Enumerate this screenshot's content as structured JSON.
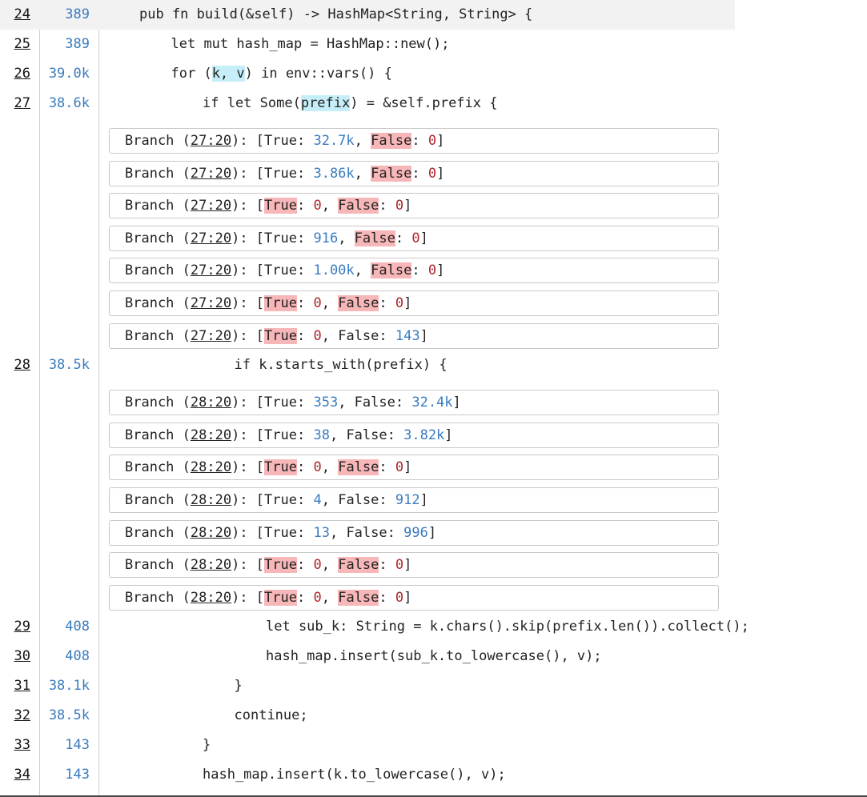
{
  "lines": [
    {
      "no": "24",
      "count": "389",
      "code": "pub fn build(&self) -> HashMap<String, String> {",
      "indent": 0,
      "highlight": true
    },
    {
      "no": "25",
      "count": "389",
      "code": "let mut hash_map = HashMap::new();",
      "indent": 1
    },
    {
      "no": "26",
      "count": "39.0k",
      "code_parts": [
        [
          "for (",
          ""
        ],
        [
          "k, v",
          "hv"
        ],
        [
          ") in env::vars() {",
          ""
        ]
      ],
      "indent": 1
    },
    {
      "no": "27",
      "count": "38.6k",
      "code_parts": [
        [
          "if let Some(",
          ""
        ],
        [
          "prefix",
          "hv"
        ],
        [
          ") = &self.prefix {",
          ""
        ]
      ],
      "indent": 2
    },
    {
      "no": "28",
      "count": "38.5k",
      "code": "if k.starts_with(prefix) {",
      "indent": 3
    },
    {
      "no": "29",
      "count": "408",
      "code": "let sub_k: String = k.chars().skip(prefix.len()).collect();",
      "indent": 4
    },
    {
      "no": "30",
      "count": "408",
      "code": "hash_map.insert(sub_k.to_lowercase(), v);",
      "indent": 4
    },
    {
      "no": "31",
      "count": "38.1k",
      "code": "}",
      "indent": 3
    },
    {
      "no": "32",
      "count": "38.5k",
      "code": "continue;",
      "indent": 3
    },
    {
      "no": "33",
      "count": "143",
      "code": "}",
      "indent": 2
    },
    {
      "no": "34",
      "count": "143",
      "code": "hash_map.insert(k.to_lowercase(), v);",
      "indent": 2
    }
  ],
  "branch_groups": [
    {
      "after_line": "27",
      "loc": "27:20",
      "branches": [
        {
          "true": "32.7k",
          "false": "0"
        },
        {
          "true": "3.86k",
          "false": "0"
        },
        {
          "true": "0",
          "false": "0"
        },
        {
          "true": "916",
          "false": "0"
        },
        {
          "true": "1.00k",
          "false": "0"
        },
        {
          "true": "0",
          "false": "0"
        },
        {
          "true": "0",
          "false": "143"
        }
      ]
    },
    {
      "after_line": "28",
      "loc": "28:20",
      "branches": [
        {
          "true": "353",
          "false": "32.4k"
        },
        {
          "true": "38",
          "false": "3.82k"
        },
        {
          "true": "0",
          "false": "0"
        },
        {
          "true": "4",
          "false": "912"
        },
        {
          "true": "13",
          "false": "996"
        },
        {
          "true": "0",
          "false": "0"
        },
        {
          "true": "0",
          "false": "0"
        }
      ]
    }
  ],
  "labels": {
    "branch": "Branch",
    "true": "True",
    "false": "False"
  },
  "colors": {
    "count": "#3a7cbf",
    "zero": "#b0262b",
    "missed_bg": "#f7b6b8",
    "hover_bg": "#c6eef9",
    "highlight_row": "#f2f2f2"
  }
}
